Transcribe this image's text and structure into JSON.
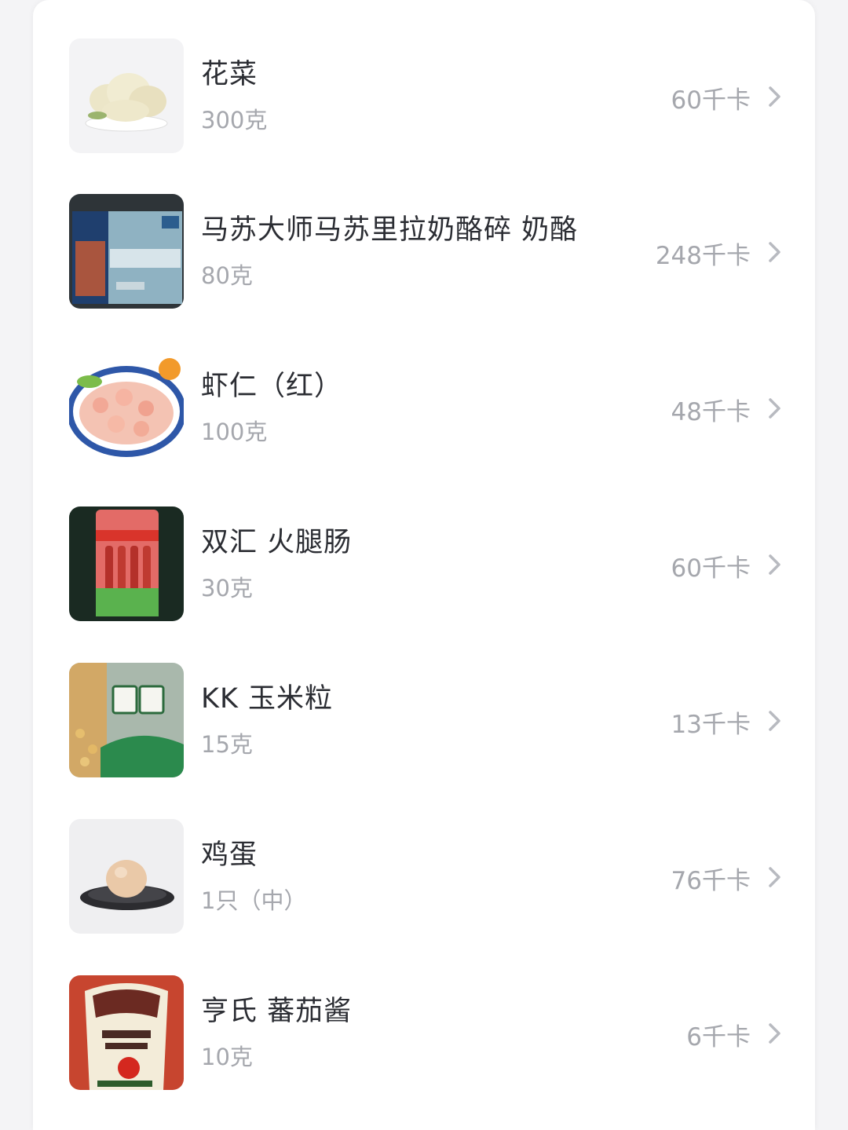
{
  "food_list": {
    "items": [
      {
        "name": "花菜",
        "amount": "300克",
        "calories": "60千卡",
        "image": "cauliflower-image"
      },
      {
        "name": "马苏大师马苏里拉奶酪碎 奶酪",
        "amount": "80克",
        "calories": "248千卡",
        "image": "mozzarella-package-image"
      },
      {
        "name": "虾仁（红）",
        "amount": "100克",
        "calories": "48千卡",
        "image": "shrimp-plate-image"
      },
      {
        "name": "双汇 火腿肠",
        "amount": "30克",
        "calories": "60千卡",
        "image": "ham-sausage-package-image"
      },
      {
        "name": "KK 玉米粒",
        "amount": "15克",
        "calories": "13千卡",
        "image": "sweet-corn-package-image"
      },
      {
        "name": "鸡蛋",
        "amount": "1只（中）",
        "calories": "76千卡",
        "image": "egg-image"
      },
      {
        "name": "亨氏 蕃茄酱",
        "amount": "10克",
        "calories": "6千卡",
        "image": "ketchup-bottle-image"
      }
    ]
  },
  "colors": {
    "name_text": "#2b2d33",
    "secondary_text": "#a5a7ad",
    "chevron": "#b8bac0",
    "card_background": "#ffffff"
  },
  "icons": {
    "row_arrow": "chevron-right-icon"
  }
}
